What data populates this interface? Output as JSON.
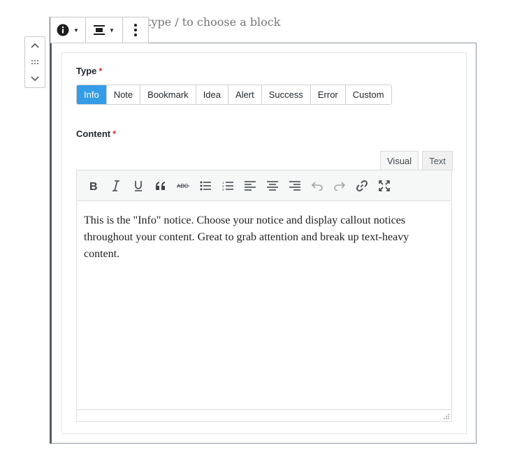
{
  "placeholder": {
    "text": "type / to choose a block"
  },
  "block_toolbar": {
    "info_icon": "info-circle-icon",
    "align_icon": "align-center-icon",
    "more_icon": "vertical-ellipsis-icon"
  },
  "mover": {
    "up_icon": "chevron-up-icon",
    "drag_icon": "drag-handle-icon",
    "down_icon": "chevron-down-icon"
  },
  "type_field": {
    "label": "Type",
    "required_mark": "*",
    "options": [
      "Info",
      "Note",
      "Bookmark",
      "Idea",
      "Alert",
      "Success",
      "Error",
      "Custom"
    ],
    "selected": "Info"
  },
  "content_field": {
    "label": "Content",
    "required_mark": "*"
  },
  "editor_tabs": {
    "visual": "Visual",
    "text": "Text",
    "active": "Visual"
  },
  "format_toolbar": {
    "buttons": [
      "bold-icon",
      "italic-icon",
      "underline-icon",
      "blockquote-icon",
      "strikethrough-icon",
      "bullet-list-icon",
      "numbered-list-icon",
      "align-left-icon",
      "align-center-icon",
      "align-right-icon",
      "undo-icon",
      "redo-icon",
      "link-icon",
      "fullscreen-icon"
    ]
  },
  "editor": {
    "content": "This is the \"Info\" notice. Choose your notice and display callout notices throughout your content. Great to grab attention and break up text-heavy content."
  },
  "colors": {
    "accent": "#349de6",
    "required": "#dc3232",
    "block_border": "#555d66"
  }
}
